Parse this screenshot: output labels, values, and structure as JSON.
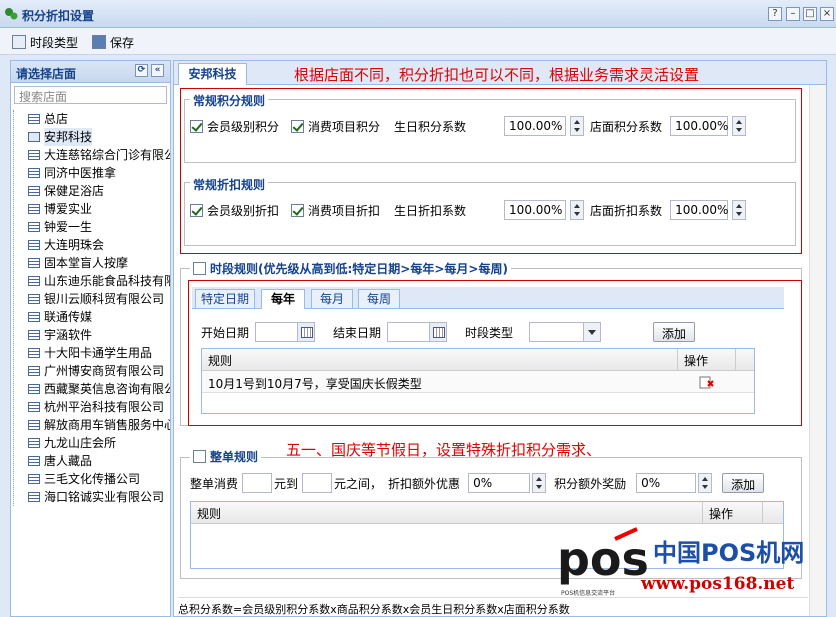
{
  "window": {
    "title": "积分折扣设置",
    "buttons": [
      "?",
      "–",
      "□",
      "×"
    ]
  },
  "toolbar": {
    "period_type": "时段类型",
    "save": "保存"
  },
  "left": {
    "header": "请选择店面",
    "search_placeholder": "搜索店面",
    "stores": [
      "总店",
      "安邦科技",
      "大连慈铭综合门诊有限公",
      "同济中医推拿",
      "保健足浴店",
      "博爱实业",
      "钟爱一生",
      "大连明珠会",
      "固本堂盲人按摩",
      "山东迪乐能食品科技有限",
      "银川云顺科贸有限公司",
      "联通传媒",
      "宇涵软件",
      "十大阳卡通学生用品",
      "广州博安商贸有限公司",
      "西藏聚英信息咨询有限公",
      "杭州平治科技有限公司",
      "解放商用车销售服务中心",
      "九龙山庄会所",
      "唐人藏品",
      "三毛文化传播公司",
      "海口铭诚实业有限公司"
    ],
    "selected": "安邦科技"
  },
  "main": {
    "tab": "安邦科技",
    "note_top": "根据店面不同，积分折扣也可以不同，根据业务需求灵活设置",
    "points": {
      "legend": "常规积分规则",
      "member": "会员级别积分",
      "consume": "消费项目积分",
      "birthday_label": "生日积分系数",
      "birthday_value": "100.00%",
      "store_label": "店面积分系数",
      "store_value": "100.00%"
    },
    "discount": {
      "legend": "常规折扣规则",
      "member": "会员级别折扣",
      "consume": "消费项目折扣",
      "birthday_label": "生日折扣系数",
      "birthday_value": "100.00%",
      "store_label": "店面折扣系数",
      "store_value": "100.00%"
    },
    "period": {
      "legend": "时段规则(优先级从高到低:特定日期>每年>每月>每周)",
      "tabs": [
        "特定日期",
        "每年",
        "每月",
        "每周"
      ],
      "active_tab": "每年",
      "start_label": "开始日期",
      "end_label": "结束日期",
      "type_label": "时段类型",
      "add": "添加",
      "grid_headers": [
        "规则",
        "操作"
      ],
      "rows": [
        {
          "rule": "10月1号到10月7号，享受国庆长假类型"
        }
      ]
    },
    "note_mid": "五一、国庆等节假日，设置特殊折扣积分需求、",
    "order": {
      "legend": "整单规则",
      "t1": "整单消费",
      "t2": "元到",
      "t3": "元之间，",
      "t4": "折扣额外优惠",
      "v1": "0%",
      "t5": "积分额外奖励",
      "v2": "0%",
      "add": "添加",
      "grid_headers": [
        "规则",
        "操作"
      ]
    },
    "footer": "总积分系数=会员级别积分系数x商品积分系数x会员生日积分系数x店面积分系数"
  },
  "watermark": {
    "logo": "pos",
    "cn": "中国POS机网",
    "url": "www.pos168.net",
    "small": "POS机信息交流平台"
  },
  "colors": {
    "accent": "#15428b",
    "note": "#e00000",
    "border": "#99bbe8"
  }
}
